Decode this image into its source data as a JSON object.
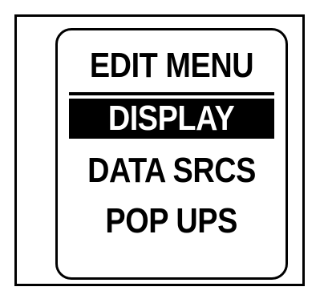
{
  "edit_menu": {
    "title": "EDIT MENU",
    "items": [
      {
        "label": "DISPLAY",
        "selected": true
      },
      {
        "label": "DATA SRCS",
        "selected": false
      },
      {
        "label": "POP UPS",
        "selected": false
      }
    ]
  },
  "colors": {
    "foreground": "#000000",
    "background": "#ffffff",
    "selection_bg": "#000000",
    "selection_text": "#ffffff"
  }
}
